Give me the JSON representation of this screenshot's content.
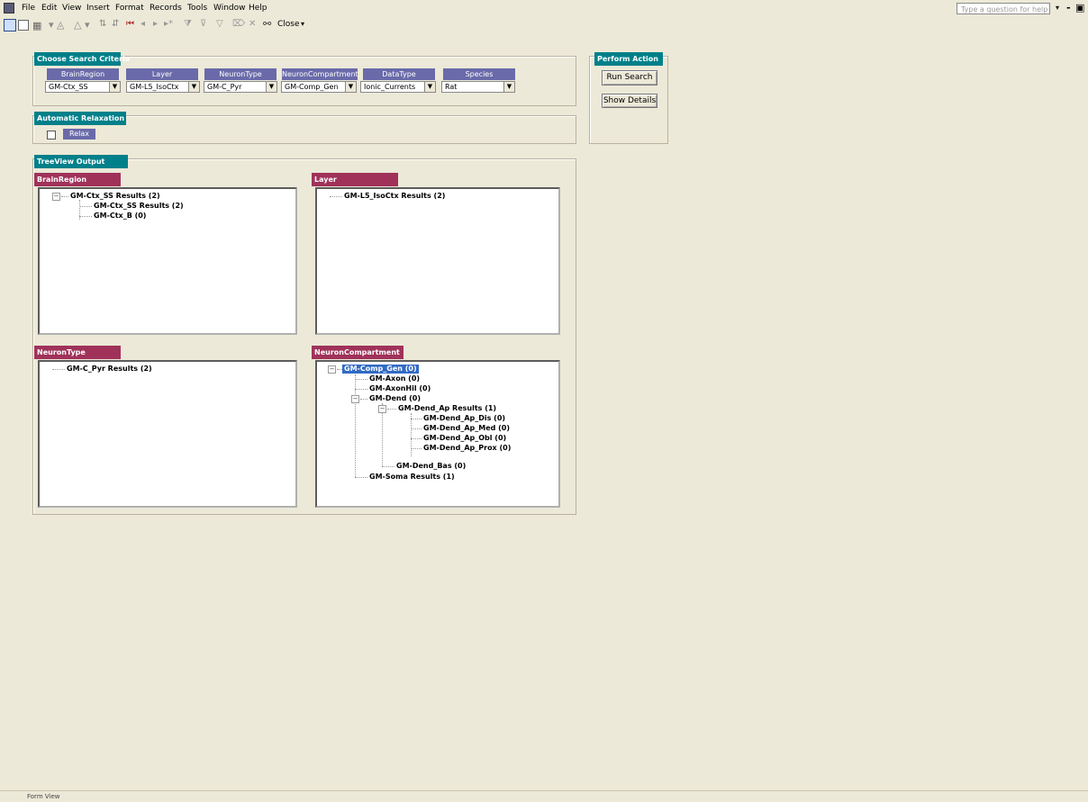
{
  "menubar": {
    "items": [
      "File",
      "Edit",
      "View",
      "Insert",
      "Format",
      "Records",
      "Tools",
      "Window",
      "Help"
    ],
    "help_placeholder": "Type a question for help"
  },
  "toolbar": {
    "close_label": "Close"
  },
  "search_criteria": {
    "title": "Choose Search Criteria",
    "fields": [
      {
        "label": "BrainRegion",
        "value": "GM-Ctx_SS"
      },
      {
        "label": "Layer",
        "value": "GM-L5_IsoCtx"
      },
      {
        "label": "NeuronType",
        "value": "GM-C_Pyr"
      },
      {
        "label": "NeuronCompartment",
        "value": "GM-Comp_Gen"
      },
      {
        "label": "DataType",
        "value": "Ionic_Currents"
      },
      {
        "label": "Species",
        "value": "Rat"
      }
    ]
  },
  "perform_action": {
    "title": "Perform Action",
    "run_label": "Run Search",
    "details_label": "Show Details"
  },
  "relaxation": {
    "title": "Automatic Relaxation",
    "button_label": "Relax"
  },
  "treeview": {
    "title": "TreeView Output",
    "panes": {
      "brain_region": {
        "title": "BrainRegion",
        "nodes": [
          "GM-Ctx_SS  Results (2)",
          "GM-Ctx_SS  Results (2)",
          "GM-Ctx_B  (0)"
        ]
      },
      "layer": {
        "title": "Layer",
        "nodes": [
          "GM-L5_IsoCtx  Results (2)"
        ]
      },
      "neuron_type": {
        "title": "NeuronType",
        "nodes": [
          "GM-C_Pyr  Results (2)"
        ]
      },
      "neuron_compartment": {
        "title": "NeuronCompartment",
        "nodes": [
          "GM-Comp_Gen  (0)",
          "GM-Axon  (0)",
          "GM-AxonHil  (0)",
          "GM-Dend  (0)",
          "GM-Dend_Ap  Results (1)",
          "GM-Dend_Ap_Dis  (0)",
          "GM-Dend_Ap_Med  (0)",
          "GM-Dend_Ap_Obl  (0)",
          "GM-Dend_Ap_Prox  (0)",
          "GM-Dend_Bas  (0)",
          "GM-Soma  Results (1)"
        ]
      }
    }
  },
  "statusbar": {
    "text": "Form View"
  },
  "colors": {
    "teal_header": "#00808A",
    "maroon_header": "#A0325A",
    "label_purple": "#6A6AAA",
    "selection": "#316AC5",
    "window_bg": "#ECE9D8"
  }
}
